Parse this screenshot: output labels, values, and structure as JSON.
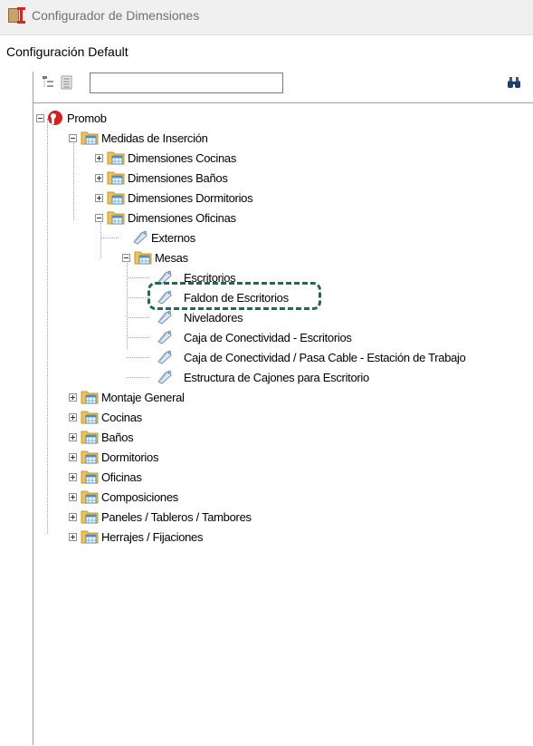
{
  "window": {
    "title": "Configurador de Dimensiones"
  },
  "config": {
    "label": "Configuración Default"
  },
  "toolbar": {
    "search_value": "",
    "search_placeholder": ""
  },
  "colors": {
    "highlight": "#1e6b52",
    "folder": "#f2c14e"
  },
  "tree": {
    "root": "Promob",
    "medidas": "Medidas de Inserción",
    "dim_cocinas": "Dimensiones Cocinas",
    "dim_banos": "Dimensiones Baños",
    "dim_dormitorios": "Dimensiones Dormitorios",
    "dim_oficinas": "Dimensiones Oficinas",
    "externos": "Externos",
    "mesas": "Mesas",
    "escritorios": "Escritorios",
    "faldon": "Faldon de Escritorios",
    "niveladores": "Niveladores",
    "caja_conectividad": "Caja de Conectividad - Escritorios",
    "caja_pasa_cable": "Caja de Conectividad / Pasa Cable - Estación de Trabajo",
    "estructura_cajones": "Estructura de Cajones para Escritorio",
    "montaje": "Montaje General",
    "cocinas": "Cocinas",
    "banos": "Baños",
    "dormitorios": "Dormitorios",
    "oficinas": "Oficinas",
    "composiciones": "Composiciones",
    "paneles": "Paneles / Tableros / Tambores",
    "herrajes": "Herrajes / Fijaciones"
  }
}
